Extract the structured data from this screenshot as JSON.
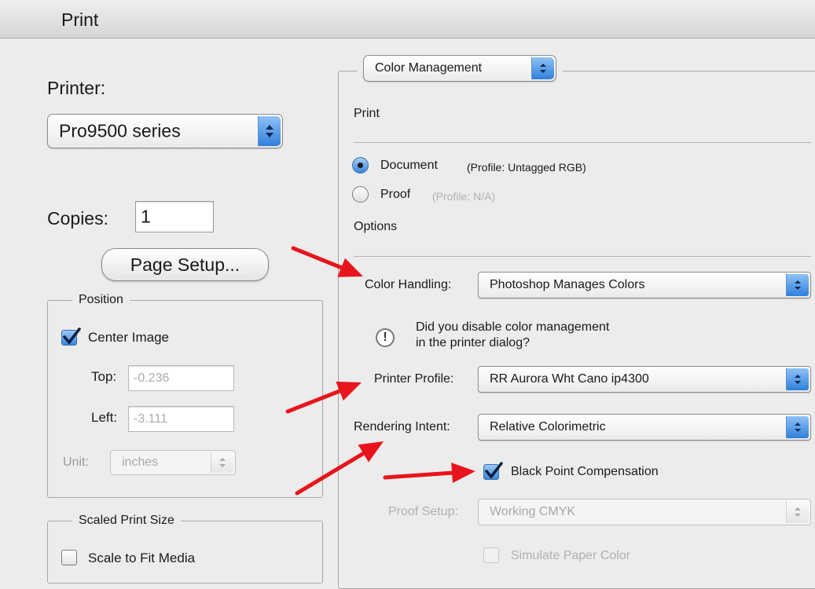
{
  "window": {
    "title": "Print"
  },
  "printer": {
    "label": "Printer:",
    "value": "Pro9500 series"
  },
  "copies": {
    "label": "Copies:",
    "value": "1"
  },
  "page_setup": {
    "label": "Page Setup..."
  },
  "position": {
    "title": "Position",
    "center_image": {
      "label": "Center Image",
      "checked": true
    },
    "top": {
      "label": "Top:",
      "value": "-0.236"
    },
    "left": {
      "label": "Left:",
      "value": "-3.111"
    },
    "unit": {
      "label": "Unit:",
      "value": "inches"
    }
  },
  "scaled": {
    "title": "Scaled Print Size",
    "scale_to_fit": {
      "label": "Scale to Fit Media",
      "checked": false
    }
  },
  "panel_select": {
    "value": "Color Management"
  },
  "print_section": {
    "title": "Print",
    "document": {
      "label": "Document",
      "note": "(Profile: Untagged RGB)",
      "selected": true
    },
    "proof": {
      "label": "Proof",
      "note": "(Profile: N/A)",
      "selected": false
    }
  },
  "options": {
    "title": "Options",
    "color_handling": {
      "label": "Color Handling:",
      "value": "Photoshop Manages Colors"
    },
    "warning": {
      "line1": "Did you disable color management",
      "line2": "in the printer dialog?"
    },
    "printer_profile": {
      "label": "Printer Profile:",
      "value": "RR Aurora Wht Cano ip4300"
    },
    "rendering_intent": {
      "label": "Rendering Intent:",
      "value": "Relative Colorimetric"
    },
    "black_point": {
      "label": "Black Point Compensation",
      "checked": true
    },
    "proof_setup": {
      "label": "Proof Setup:",
      "value": "Working CMYK"
    },
    "simulate_paper": {
      "label": "Simulate Paper Color",
      "checked": false
    }
  },
  "colors": {
    "arrow": "#e8141c",
    "accent": "#3a84dc"
  }
}
